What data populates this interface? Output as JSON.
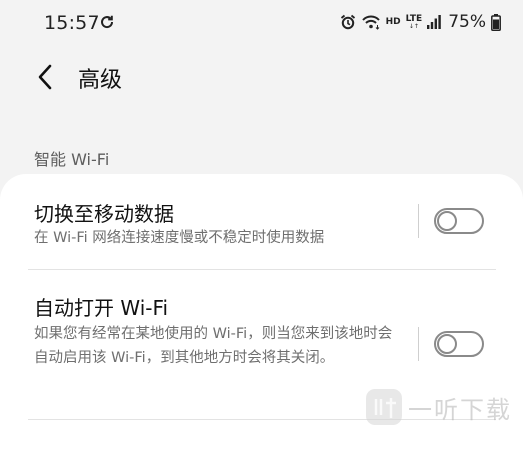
{
  "status_bar": {
    "time": "15:57",
    "hd_label": "HD",
    "lte_label": "LTE",
    "lte_arrows": "↓↑",
    "battery": "75%",
    "icons": [
      "sync-icon",
      "alarm-icon",
      "wifi-icon",
      "signal-icon",
      "battery-icon"
    ]
  },
  "app_bar": {
    "back_icon": "chevron-left-icon",
    "title": "高级"
  },
  "section": {
    "header": "智能 Wi-Fi"
  },
  "settings": [
    {
      "title": "切换至移动数据",
      "description": "在 Wi-Fi 网络连接速度慢或不稳定时使用数据",
      "enabled": false
    },
    {
      "title": "自动打开 Wi-Fi",
      "description": "如果您有经常在某地使用的 Wi-Fi，则当您来到该地时会自动启用该 Wi-Fi，到其他地方时会将其关闭。",
      "enabled": false
    }
  ],
  "watermark": {
    "text": "一听下载"
  },
  "colors": {
    "background": "#f3f3f3",
    "card": "#ffffff",
    "secondary_text": "#6f6f6f",
    "toggle_off": "#8a8a8a"
  }
}
